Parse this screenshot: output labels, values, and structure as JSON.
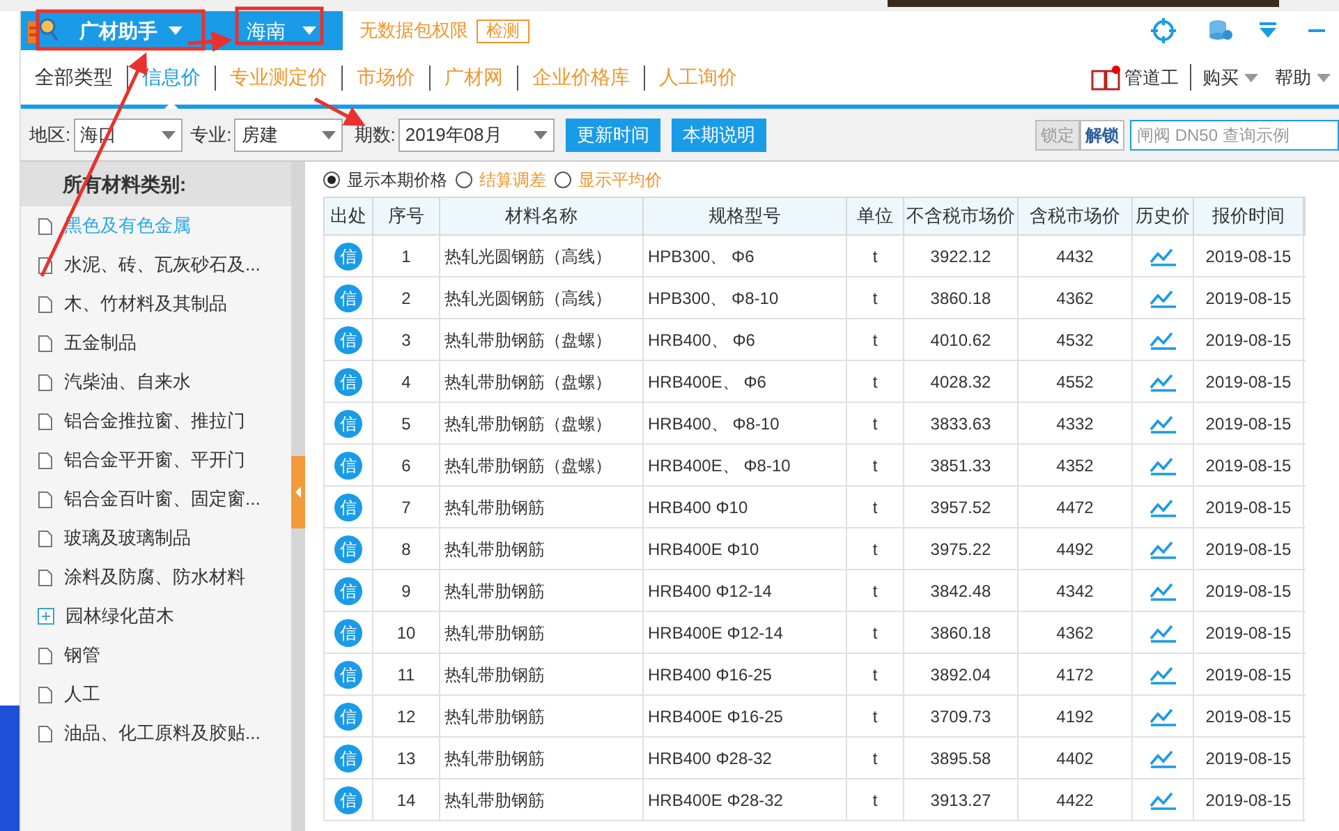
{
  "app": {
    "name": "广材助手",
    "region_menu": "海南",
    "notice": "无数据包权限",
    "check_button": "检测"
  },
  "tabs": [
    {
      "label": "全部类型",
      "selected": false,
      "kind": "plain"
    },
    {
      "label": "信息价",
      "selected": true,
      "kind": "plain"
    },
    {
      "label": "专业测定价",
      "selected": false,
      "kind": "accent"
    },
    {
      "label": "市场价",
      "selected": false,
      "kind": "accent"
    },
    {
      "label": "广材网",
      "selected": false,
      "kind": "accent"
    },
    {
      "label": "企业价格库",
      "selected": false,
      "kind": "accent"
    },
    {
      "label": "人工询价",
      "selected": false,
      "kind": "accent"
    }
  ],
  "toolbar_right": {
    "ad_text": "管道工",
    "buy": "购买",
    "help": "帮助"
  },
  "filters": {
    "region_label": "地区:",
    "region": "海口",
    "major_label": "专业:",
    "major": "房建",
    "period_label": "期数:",
    "period": "2019年08月",
    "update_button": "更新时间",
    "notes_button": "本期说明",
    "lock_button": "锁定",
    "lock_disabled": true,
    "unlock_button": "解锁",
    "search_placeholder": "闸阀 DN50 查询示例"
  },
  "sidebar": {
    "title": "所有材料类别:",
    "items": [
      {
        "label": "黑色及有色金属",
        "selected": true,
        "kind": "leaf"
      },
      {
        "label": "水泥、砖、瓦灰砂石及...",
        "selected": false,
        "kind": "leaf"
      },
      {
        "label": "木、竹材料及其制品",
        "selected": false,
        "kind": "leaf"
      },
      {
        "label": "五金制品",
        "selected": false,
        "kind": "leaf"
      },
      {
        "label": "汽柴油、自来水",
        "selected": false,
        "kind": "leaf"
      },
      {
        "label": "铝合金推拉窗、推拉门",
        "selected": false,
        "kind": "leaf"
      },
      {
        "label": "铝合金平开窗、平开门",
        "selected": false,
        "kind": "leaf"
      },
      {
        "label": "铝合金百叶窗、固定窗...",
        "selected": false,
        "kind": "leaf"
      },
      {
        "label": "玻璃及玻璃制品",
        "selected": false,
        "kind": "leaf"
      },
      {
        "label": "涂料及防腐、防水材料",
        "selected": false,
        "kind": "leaf"
      },
      {
        "label": "园林绿化苗木",
        "selected": false,
        "kind": "group"
      },
      {
        "label": "钢管",
        "selected": false,
        "kind": "leaf"
      },
      {
        "label": "人工",
        "selected": false,
        "kind": "leaf"
      },
      {
        "label": "油品、化工原料及胶贴...",
        "selected": false,
        "kind": "leaf"
      }
    ]
  },
  "view_options": [
    {
      "label": "显示本期价格",
      "selected": true
    },
    {
      "label": "结算调差",
      "selected": false
    },
    {
      "label": "显示平均价",
      "selected": false
    }
  ],
  "table": {
    "columns": [
      "出处",
      "序号",
      "材料名称",
      "规格型号",
      "单位",
      "不含税市场价",
      "含税市场价",
      "历史价",
      "报价时间"
    ],
    "rows": [
      {
        "source": "信",
        "no": "1",
        "name": "热轧光圆钢筋（高线）",
        "spec": "HPB300、 Φ6",
        "unit": "t",
        "price": "3922.12",
        "price_tax": "4432",
        "date": "2019-08-15"
      },
      {
        "source": "信",
        "no": "2",
        "name": "热轧光圆钢筋（高线）",
        "spec": "HPB300、 Φ8-10",
        "unit": "t",
        "price": "3860.18",
        "price_tax": "4362",
        "date": "2019-08-15"
      },
      {
        "source": "信",
        "no": "3",
        "name": "热轧带肋钢筋（盘螺）",
        "spec": "HRB400、 Φ6",
        "unit": "t",
        "price": "4010.62",
        "price_tax": "4532",
        "date": "2019-08-15"
      },
      {
        "source": "信",
        "no": "4",
        "name": "热轧带肋钢筋（盘螺）",
        "spec": "HRB400E、 Φ6",
        "unit": "t",
        "price": "4028.32",
        "price_tax": "4552",
        "date": "2019-08-15"
      },
      {
        "source": "信",
        "no": "5",
        "name": "热轧带肋钢筋（盘螺）",
        "spec": "HRB400、 Φ8-10",
        "unit": "t",
        "price": "3833.63",
        "price_tax": "4332",
        "date": "2019-08-15"
      },
      {
        "source": "信",
        "no": "6",
        "name": "热轧带肋钢筋（盘螺）",
        "spec": "HRB400E、 Φ8-10",
        "unit": "t",
        "price": "3851.33",
        "price_tax": "4352",
        "date": "2019-08-15"
      },
      {
        "source": "信",
        "no": "7",
        "name": "热轧带肋钢筋",
        "spec": "HRB400 Φ10",
        "unit": "t",
        "price": "3957.52",
        "price_tax": "4472",
        "date": "2019-08-15"
      },
      {
        "source": "信",
        "no": "8",
        "name": "热轧带肋钢筋",
        "spec": "HRB400E Φ10",
        "unit": "t",
        "price": "3975.22",
        "price_tax": "4492",
        "date": "2019-08-15"
      },
      {
        "source": "信",
        "no": "9",
        "name": "热轧带肋钢筋",
        "spec": "HRB400 Φ12-14",
        "unit": "t",
        "price": "3842.48",
        "price_tax": "4342",
        "date": "2019-08-15"
      },
      {
        "source": "信",
        "no": "10",
        "name": "热轧带肋钢筋",
        "spec": "HRB400E Φ12-14",
        "unit": "t",
        "price": "3860.18",
        "price_tax": "4362",
        "date": "2019-08-15"
      },
      {
        "source": "信",
        "no": "11",
        "name": "热轧带肋钢筋",
        "spec": "HRB400 Φ16-25",
        "unit": "t",
        "price": "3892.04",
        "price_tax": "4172",
        "date": "2019-08-15"
      },
      {
        "source": "信",
        "no": "12",
        "name": "热轧带肋钢筋",
        "spec": "HRB400E Φ16-25",
        "unit": "t",
        "price": "3709.73",
        "price_tax": "4192",
        "date": "2019-08-15"
      },
      {
        "source": "信",
        "no": "13",
        "name": "热轧带肋钢筋",
        "spec": "HRB400 Φ28-32",
        "unit": "t",
        "price": "3895.58",
        "price_tax": "4402",
        "date": "2019-08-15"
      },
      {
        "source": "信",
        "no": "14",
        "name": "热轧带肋钢筋",
        "spec": "HRB400E Φ28-32",
        "unit": "t",
        "price": "3913.27",
        "price_tax": "4422",
        "date": "2019-08-15"
      }
    ]
  }
}
